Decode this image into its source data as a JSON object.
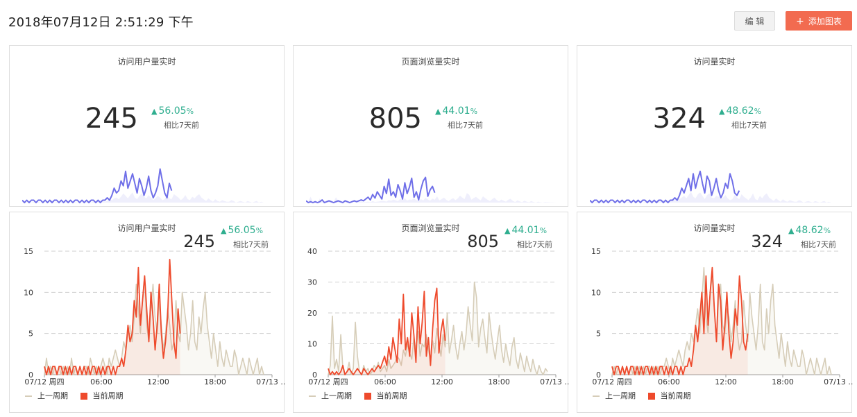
{
  "header": {
    "datetime": "2018年07月12日 2:51:29 下午",
    "edit_label": "编 辑",
    "add_icon": "+",
    "add_label": "添加图表"
  },
  "cards": [
    {
      "title": "访问用户量实时",
      "value": "245",
      "change": "56.05",
      "pct": "%",
      "compare": "相比7天前"
    },
    {
      "title": "页面浏览量实时",
      "value": "805",
      "change": "44.01",
      "pct": "%",
      "compare": "相比7天前"
    },
    {
      "title": "访问量实时",
      "value": "324",
      "change": "48.62",
      "pct": "%",
      "compare": "相比7天前"
    }
  ],
  "trend_icon": "up-triangle",
  "colors": {
    "up": "#2fae8f",
    "sparkline": "#6f6fe8",
    "previous": "#d6cdb8",
    "current": "#ee4a2c",
    "accent": "#f26b50"
  },
  "legend": {
    "previous": "上一周期",
    "current": "当前周期"
  },
  "chart_data": [
    {
      "type": "line",
      "title": "访问用户量实时",
      "x_ticks": [
        "07/12 周四",
        "06:00",
        "12:00",
        "18:00",
        "07/13 ..."
      ],
      "ylim": [
        0,
        15
      ],
      "y_ticks": [
        0,
        5,
        10,
        15
      ],
      "grid": true,
      "legend_position": "bottom-left",
      "series": [
        {
          "name": "上一周期",
          "values": [
            0,
            2,
            0,
            1,
            0,
            1,
            0,
            1,
            0,
            1,
            0,
            1,
            0,
            2,
            0,
            1,
            0,
            1,
            0,
            1,
            1,
            0,
            2,
            1,
            0,
            1,
            0,
            1,
            2,
            1,
            0,
            2,
            1,
            2,
            3,
            2,
            1,
            2,
            4,
            3,
            5,
            6,
            4,
            7,
            11,
            8,
            5,
            9,
            12,
            6,
            4,
            8,
            11,
            7,
            5,
            9,
            6,
            3,
            5,
            8,
            6,
            3,
            4,
            9,
            5,
            4,
            10,
            8,
            6,
            3,
            5,
            9,
            4,
            3,
            7,
            5,
            8,
            10,
            6,
            4,
            2,
            5,
            3,
            1,
            4,
            2,
            1,
            3,
            2,
            1,
            1,
            3,
            2,
            0,
            1,
            2,
            1,
            0,
            2,
            1,
            0,
            1,
            2,
            0,
            1,
            0
          ]
        },
        {
          "name": "当前周期",
          "values": [
            1,
            0,
            1,
            0,
            1,
            1,
            0,
            1,
            1,
            0,
            1,
            0,
            1,
            0,
            1,
            1,
            0,
            1,
            0,
            1,
            0,
            1,
            0,
            1,
            1,
            0,
            1,
            0,
            1,
            0,
            1,
            1,
            0,
            1,
            0,
            1,
            1,
            2,
            1,
            3,
            6,
            4,
            5,
            9,
            7,
            13,
            6,
            9,
            12,
            8,
            4,
            10,
            7,
            3,
            6,
            11,
            5,
            2,
            4,
            7,
            14,
            9,
            4,
            2,
            8,
            5
          ]
        }
      ]
    },
    {
      "type": "line",
      "title": "页面浏览量实时",
      "x_ticks": [
        "07/12 周四",
        "06:00",
        "12:00",
        "18:00",
        "07/13 ..."
      ],
      "ylim": [
        0,
        40
      ],
      "y_ticks": [
        0,
        10,
        20,
        30,
        40
      ],
      "grid": true,
      "legend_position": "bottom-left",
      "series": [
        {
          "name": "上一周期",
          "values": [
            0,
            3,
            19,
            2,
            5,
            1,
            13,
            2,
            0,
            1,
            4,
            0,
            2,
            17,
            6,
            1,
            0,
            3,
            1,
            2,
            0,
            1,
            3,
            2,
            4,
            1,
            2,
            3,
            1,
            5,
            2,
            3,
            4,
            6,
            5,
            3,
            8,
            6,
            10,
            7,
            5,
            12,
            8,
            14,
            6,
            10,
            9,
            13,
            8,
            5,
            11,
            7,
            15,
            10,
            6,
            13,
            9,
            20,
            7,
            11,
            16,
            9,
            5,
            10,
            14,
            8,
            13,
            22,
            16,
            11,
            30,
            25,
            9,
            15,
            18,
            12,
            7,
            20,
            14,
            9,
            5,
            11,
            16,
            8,
            4,
            10,
            6,
            3,
            9,
            12,
            5,
            2,
            7,
            4,
            1,
            6,
            3,
            1,
            5,
            2,
            0,
            3,
            1,
            0,
            2,
            1
          ]
        },
        {
          "name": "当前周期",
          "values": [
            2,
            0,
            1,
            0,
            1,
            0,
            1,
            3,
            0,
            1,
            2,
            1,
            0,
            1,
            2,
            1,
            0,
            2,
            1,
            0,
            1,
            2,
            1,
            2,
            3,
            2,
            4,
            6,
            3,
            9,
            5,
            12,
            8,
            4,
            18,
            10,
            26,
            8,
            12,
            6,
            20,
            13,
            4,
            22,
            10,
            17,
            27,
            6,
            12,
            3,
            15,
            24,
            28,
            7,
            14,
            18,
            11
          ]
        }
      ]
    },
    {
      "type": "line",
      "title": "访问量实时",
      "x_ticks": [
        "07/12 周四",
        "06:00",
        "12:00",
        "18:00",
        "07/13 ..."
      ],
      "ylim": [
        0,
        15
      ],
      "y_ticks": [
        0,
        5,
        10,
        15
      ],
      "grid": true,
      "legend_position": "bottom-left",
      "series": [
        {
          "name": "上一周期",
          "values": [
            0,
            1,
            0,
            1,
            0,
            1,
            0,
            1,
            0,
            1,
            0,
            1,
            0,
            1,
            0,
            1,
            0,
            1,
            1,
            0,
            1,
            0,
            1,
            0,
            1,
            1,
            2,
            1,
            0,
            2,
            1,
            2,
            3,
            2,
            1,
            3,
            4,
            3,
            5,
            4,
            6,
            8,
            5,
            9,
            13,
            7,
            5,
            10,
            12,
            8,
            4,
            9,
            11,
            6,
            5,
            8,
            7,
            4,
            6,
            9,
            5,
            3,
            4,
            9,
            6,
            4,
            10,
            7,
            5,
            3,
            6,
            11,
            4,
            3,
            8,
            5,
            9,
            11,
            6,
            4,
            2,
            5,
            3,
            1,
            4,
            2,
            1,
            3,
            2,
            1,
            1,
            3,
            2,
            0,
            1,
            2,
            1,
            0,
            2,
            1,
            0,
            1,
            2,
            0,
            1,
            0
          ]
        },
        {
          "name": "当前周期",
          "values": [
            1,
            0,
            1,
            1,
            0,
            1,
            0,
            1,
            0,
            1,
            1,
            0,
            1,
            0,
            1,
            0,
            1,
            1,
            0,
            1,
            0,
            1,
            0,
            1,
            1,
            0,
            1,
            0,
            1,
            0,
            1,
            1,
            0,
            1,
            0,
            1,
            1,
            2,
            1,
            3,
            6,
            4,
            7,
            10,
            5,
            12,
            6,
            10,
            13,
            8,
            4,
            11,
            9,
            3,
            6,
            10,
            5,
            2,
            4,
            8,
            6,
            12,
            9,
            4,
            3,
            5
          ]
        }
      ]
    }
  ]
}
